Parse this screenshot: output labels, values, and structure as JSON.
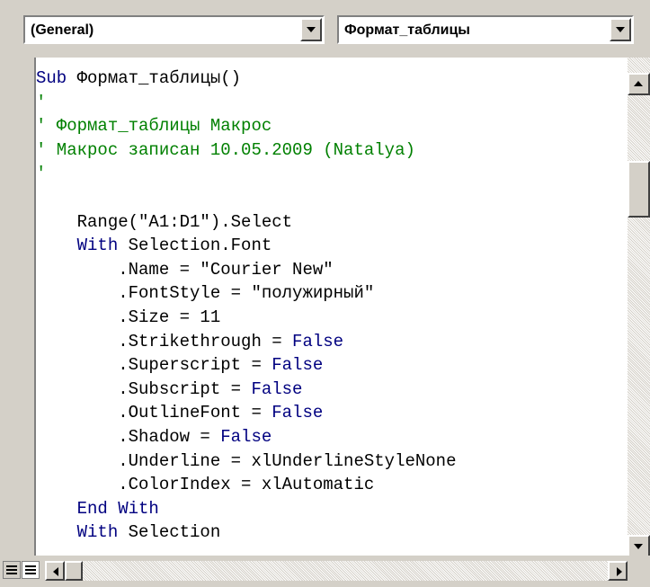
{
  "toolbar": {
    "object_combo": {
      "value": "(General)"
    },
    "procedure_combo": {
      "value": "Формат_таблицы"
    }
  },
  "code_lines": [
    [
      {
        "t": "Sub",
        "c": "kw"
      },
      {
        "t": " Формат_таблицы()",
        "c": ""
      }
    ],
    [
      {
        "t": "'",
        "c": "cm"
      }
    ],
    [
      {
        "t": "' Формат_таблицы Макрос",
        "c": "cm"
      }
    ],
    [
      {
        "t": "' Макрос записан 10.05.2009 (Natalya)",
        "c": "cm"
      }
    ],
    [
      {
        "t": "'",
        "c": "cm"
      }
    ],
    [
      {
        "t": "",
        "c": ""
      }
    ],
    [
      {
        "t": "    Range(\"A1:D1\").Select",
        "c": ""
      }
    ],
    [
      {
        "t": "    ",
        "c": ""
      },
      {
        "t": "With",
        "c": "kw"
      },
      {
        "t": " Selection.Font",
        "c": ""
      }
    ],
    [
      {
        "t": "        .Name = \"Courier New\"",
        "c": ""
      }
    ],
    [
      {
        "t": "        .FontStyle = \"полужирный\"",
        "c": ""
      }
    ],
    [
      {
        "t": "        .Size = 11",
        "c": ""
      }
    ],
    [
      {
        "t": "        .Strikethrough = ",
        "c": ""
      },
      {
        "t": "False",
        "c": "kw"
      }
    ],
    [
      {
        "t": "        .Superscript = ",
        "c": ""
      },
      {
        "t": "False",
        "c": "kw"
      }
    ],
    [
      {
        "t": "        .Subscript = ",
        "c": ""
      },
      {
        "t": "False",
        "c": "kw"
      }
    ],
    [
      {
        "t": "        .OutlineFont = ",
        "c": ""
      },
      {
        "t": "False",
        "c": "kw"
      }
    ],
    [
      {
        "t": "        .Shadow = ",
        "c": ""
      },
      {
        "t": "False",
        "c": "kw"
      }
    ],
    [
      {
        "t": "        .Underline = xlUnderlineStyleNone",
        "c": ""
      }
    ],
    [
      {
        "t": "        .ColorIndex = xlAutomatic",
        "c": ""
      }
    ],
    [
      {
        "t": "    ",
        "c": ""
      },
      {
        "t": "End With",
        "c": "kw"
      }
    ],
    [
      {
        "t": "    ",
        "c": ""
      },
      {
        "t": "With",
        "c": "kw"
      },
      {
        "t": " Selection",
        "c": ""
      }
    ]
  ],
  "colors": {
    "keyword": "#000080",
    "comment": "#008000",
    "text": "#000000",
    "chrome": "#d4d0c8"
  }
}
